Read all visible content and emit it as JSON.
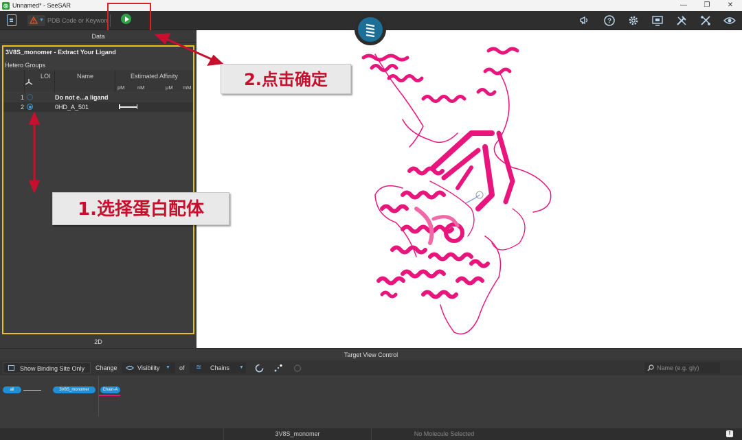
{
  "window": {
    "title": "Unnamed* - SeeSAR",
    "controls": {
      "minimize": "—",
      "restore": "❐",
      "close": "✕"
    }
  },
  "toolbar": {
    "search_placeholder": "PDB Code or Keyword"
  },
  "left_panel": {
    "header": "Data",
    "card_title": "3V8S_monomer - Extract Your Ligand",
    "subtitle": "Hetero Groups",
    "columns": {
      "loi": "LOI",
      "name": "Name",
      "affinity": "Estimated Affinity"
    },
    "units": [
      "pM",
      "nM",
      "µM",
      "mM"
    ],
    "rows": [
      {
        "num": "1",
        "name": "Do not e...a ligand",
        "selected": false
      },
      {
        "num": "2",
        "name": "0HD_A_501",
        "selected": true
      }
    ],
    "footer": "2D"
  },
  "callouts": {
    "step1": "1.选择蛋白配体",
    "step2": "2.点击确定"
  },
  "target_view": {
    "header": "Target View Control",
    "show_binding_site": "Show Binding Site Only",
    "change": "Change",
    "visibility": "Visibility",
    "of": "of",
    "chains": "Chains",
    "name_placeholder": "Name (e.g. gly)",
    "pills": {
      "all": "all",
      "monomer": "3V8S_monomer",
      "chain": "Chain-A"
    }
  },
  "status_bar": {
    "center": "3V8S_monomer",
    "molecule": "No Molecule Selected"
  },
  "colors": {
    "protein": "#e8157d",
    "highlight": "#e8c320",
    "accent": "#1f8fd6",
    "annotation": "#e02020"
  }
}
